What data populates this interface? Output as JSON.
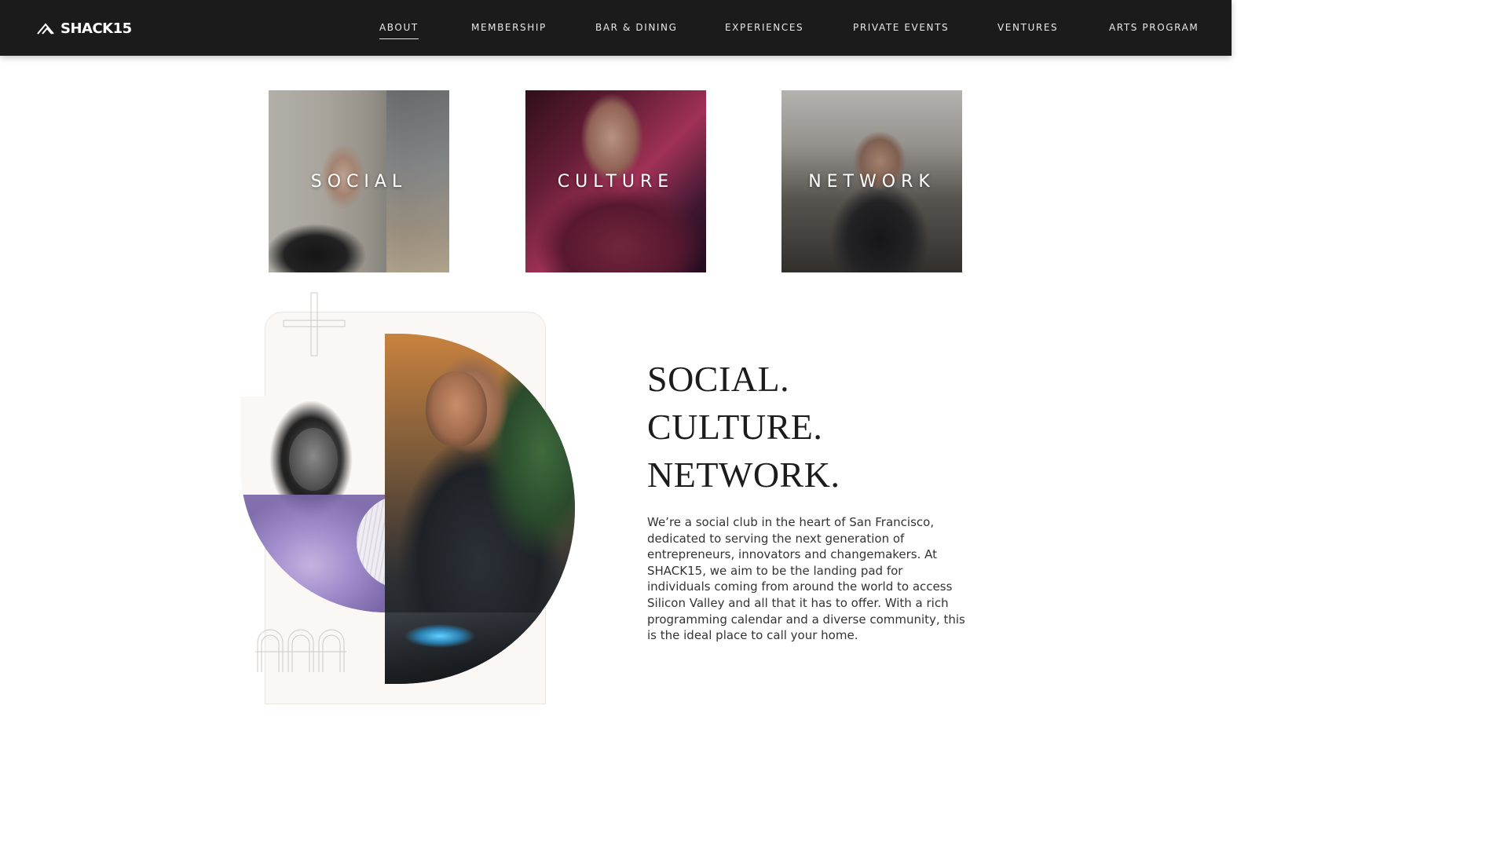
{
  "header": {
    "logo_text": "SHACK15",
    "nav": [
      {
        "label": "ABOUT",
        "active": true
      },
      {
        "label": "MEMBERSHIP",
        "active": false
      },
      {
        "label": "BAR & DINING",
        "active": false
      },
      {
        "label": "EXPERIENCES",
        "active": false
      },
      {
        "label": "PRIVATE EVENTS",
        "active": false
      },
      {
        "label": "VENTURES",
        "active": false
      },
      {
        "label": "ARTS PROGRAM",
        "active": false
      }
    ]
  },
  "tiles": [
    {
      "label": "SOCIAL"
    },
    {
      "label": "CULTURE"
    },
    {
      "label": "NETWORK"
    }
  ],
  "headline": {
    "line1": "SOCIAL.",
    "line2": "CULTURE.",
    "line3": "NETWORK."
  },
  "body_text": "We’re a social club in the heart of San Francisco, dedicated to serving the next generation of entrepreneurs, innovators and changemakers. At SHACK15, we aim to be the landing pad for individuals coming from around the world to access Silicon Valley and all that it has to offer. With a rich programming calendar and a diverse community, this is the ideal place to call your home.",
  "colors": {
    "header_bg": "#1b1b1b",
    "nav_text": "#e8e8e8",
    "panel_bg": "#fbf7f4",
    "headline_text": "#1c1c1c"
  }
}
